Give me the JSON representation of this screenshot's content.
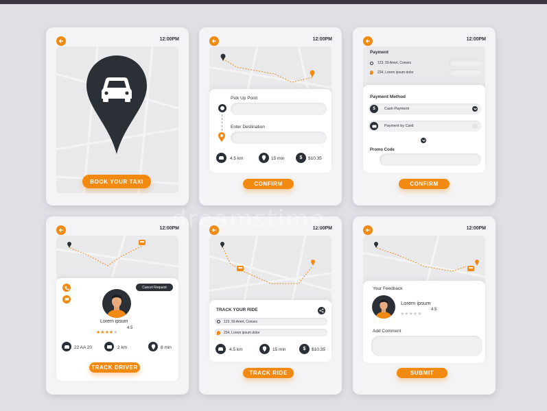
{
  "time": "12:00PM",
  "colors": {
    "accent": "#f28a12",
    "dark": "#2b2f36",
    "background": "#dfe0e6"
  },
  "screen1": {
    "button": "BOOK YOUR TAXI"
  },
  "screen2": {
    "pickup_label": "Pick Up Point",
    "destination_label": "Enter Destination",
    "distance": "4.5 km",
    "duration": "15 min",
    "price": "$10.35",
    "button": "CONFIRM"
  },
  "screen3": {
    "payment_title": "Payment",
    "address1": "123, 59 Amet, Consec",
    "address2": "234, Lorem ipsum dolor",
    "method_title": "Payment Method",
    "cash": "Cash Payment",
    "card": "Payment by Card",
    "promo": "Promo Code",
    "button": "CONFIRM"
  },
  "screen4": {
    "cancel": "Cancel Request",
    "driver_name": "Lorem ipsum",
    "rating": "4.5",
    "plate": "22 AA 20",
    "distance": "2 km",
    "eta": "8 min",
    "button": "TRACK DRIVER"
  },
  "screen5": {
    "title": "TRACK YOUR RIDE",
    "address1": "123, 59 Amet, Consec",
    "address2": "234, Lorem ipsum dolor",
    "distance": "4.5 km",
    "duration": "15 min",
    "price": "$10.35",
    "button": "TRACK RIDE"
  },
  "screen6": {
    "feedback_title": "Your Feedback",
    "driver_name": "Lorem ipsum",
    "rating": "4.5",
    "comment_title": "Add Comment",
    "button": "SUBMIT"
  },
  "watermark": "dreamstime"
}
